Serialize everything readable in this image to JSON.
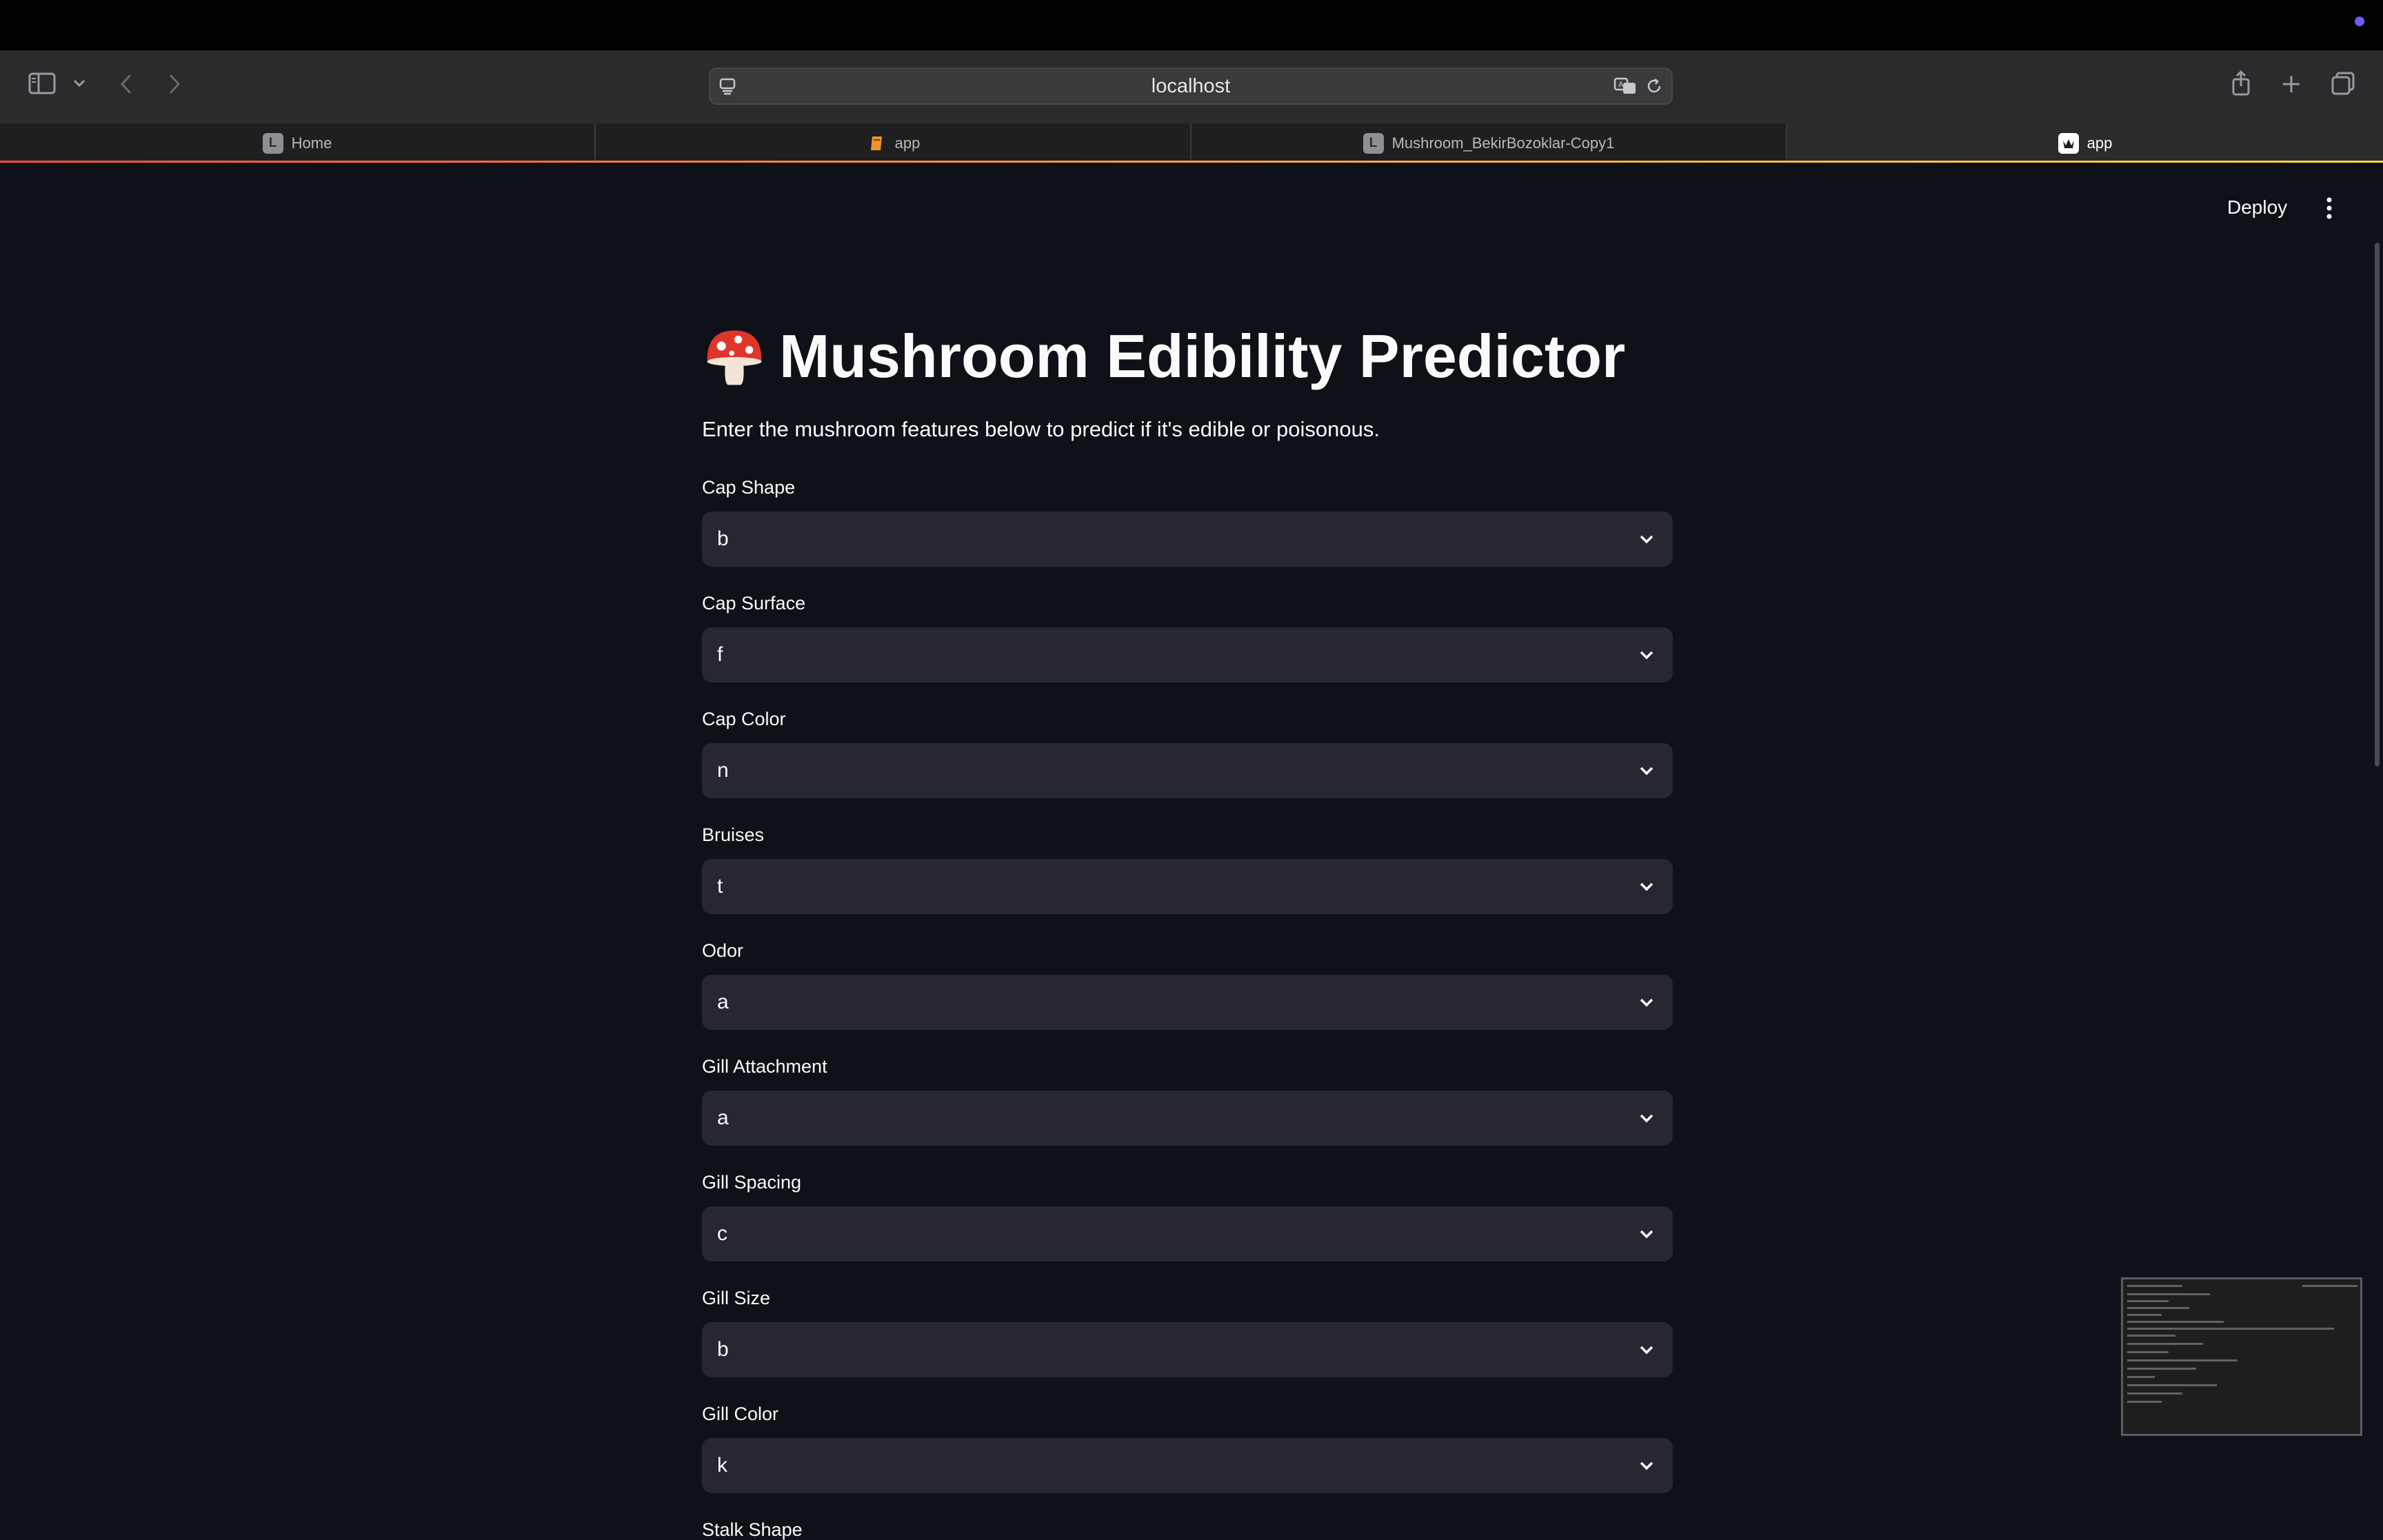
{
  "browser": {
    "address": "localhost",
    "tabs": [
      {
        "label": "Home",
        "favicon": "L",
        "active": false
      },
      {
        "label": "app",
        "favicon": "book-icon",
        "active": false
      },
      {
        "label": "Mushroom_BekirBozoklar-Copy1",
        "favicon": "L",
        "active": false
      },
      {
        "label": "app",
        "favicon": "streamlit-crown-icon",
        "active": true
      }
    ]
  },
  "header": {
    "deploy_label": "Deploy"
  },
  "page": {
    "title": "Mushroom Edibility Predictor",
    "title_icon": "mushroom-icon",
    "subtitle": "Enter the mushroom features below to predict if it's edible or poisonous."
  },
  "fields": [
    {
      "label": "Cap Shape",
      "value": "b"
    },
    {
      "label": "Cap Surface",
      "value": "f"
    },
    {
      "label": "Cap Color",
      "value": "n"
    },
    {
      "label": "Bruises",
      "value": "t"
    },
    {
      "label": "Odor",
      "value": "a"
    },
    {
      "label": "Gill Attachment",
      "value": "a"
    },
    {
      "label": "Gill Spacing",
      "value": "c"
    },
    {
      "label": "Gill Size",
      "value": "b"
    },
    {
      "label": "Gill Color",
      "value": "k"
    },
    {
      "label": "Stalk Shape"
    }
  ],
  "colors": {
    "background": "#0e1117",
    "select_bg": "#262730",
    "accent": "#ff4b4b"
  }
}
